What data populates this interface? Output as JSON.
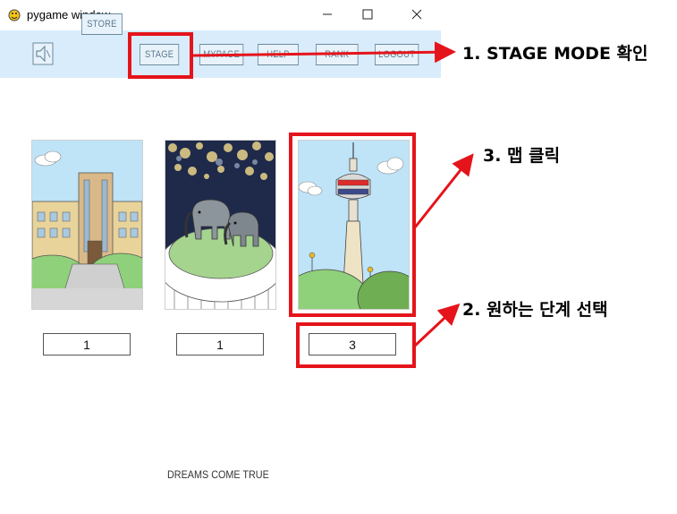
{
  "window": {
    "title": "pygame window",
    "controls": [
      "minimize",
      "maximize",
      "close"
    ]
  },
  "menu": {
    "buttons": [
      {
        "label": "STORE"
      },
      {
        "label": "STAGE"
      },
      {
        "label": "MYPAGE"
      },
      {
        "label": "HELP"
      },
      {
        "label": "RANK"
      },
      {
        "label": "LOGOUT"
      }
    ],
    "sound_icon": "speaker-muted-icon"
  },
  "maps": [
    {
      "scene": "school",
      "stage": "1"
    },
    {
      "scene": "elephants",
      "stage": "1"
    },
    {
      "scene": "tower",
      "stage": "3"
    }
  ],
  "footer": "DREAMS COME TRUE",
  "annotations": [
    "1. STAGE MODE 확인",
    "2. 원하는 단계 선택",
    "3. 맵 클릭"
  ],
  "colors": {
    "menu_bg": "#d8ecfb",
    "highlight": "#e5141b"
  }
}
